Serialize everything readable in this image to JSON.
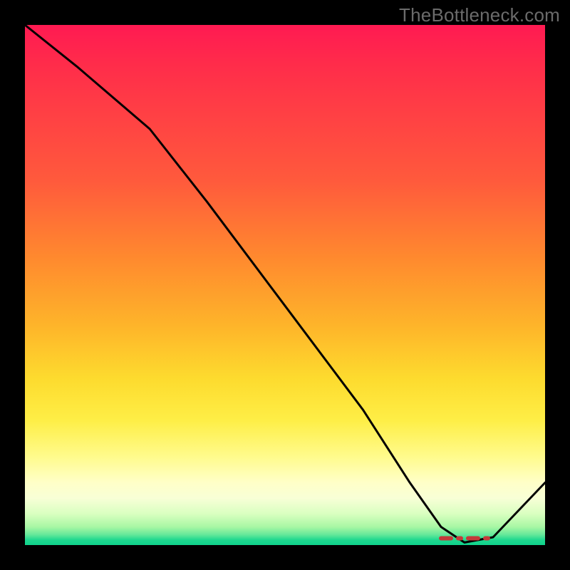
{
  "watermark": "TheBottleneck.com",
  "colors": {
    "curve": "#000000",
    "marker": "#c43a3a",
    "gradient_top": "#ff1a52",
    "gradient_bottom": "#10d28c",
    "frame": "#000000"
  },
  "chart_data": {
    "type": "line",
    "title": "",
    "xlabel": "",
    "ylabel": "",
    "xlim": [
      0,
      100
    ],
    "ylim": [
      0,
      100
    ],
    "series": [
      {
        "name": "bottleneck_curve",
        "x": [
          0,
          10,
          24,
          35,
          50,
          65,
          74,
          80,
          84.5,
          90,
          100
        ],
        "y": [
          100,
          92,
          80,
          66,
          46,
          26,
          12,
          3.5,
          0.5,
          1.5,
          12
        ]
      }
    ],
    "optimal_range": {
      "x_start": 80,
      "x_end": 90,
      "y": 1.3
    },
    "annotations": []
  }
}
